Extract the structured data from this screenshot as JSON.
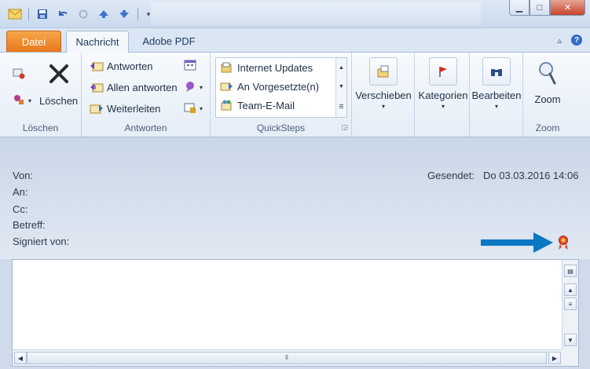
{
  "tabs": {
    "datei": "Datei",
    "nachricht": "Nachricht",
    "adobe_pdf": "Adobe PDF"
  },
  "ribbon": {
    "loeschen": {
      "delete_label": "Löschen",
      "group_label": "Löschen"
    },
    "antworten": {
      "reply": "Antworten",
      "reply_all": "Allen antworten",
      "forward": "Weiterleiten",
      "group_label": "Antworten"
    },
    "quicksteps": {
      "items": [
        "Internet Updates",
        "An Vorgesetzte(n)",
        "Team-E-Mail"
      ],
      "group_label": "QuickSteps"
    },
    "verschieben": "Verschieben",
    "kategorien": "Kategorien",
    "bearbeiten": "Bearbeiten",
    "zoom": {
      "label": "Zoom",
      "group_label": "Zoom"
    }
  },
  "header": {
    "from_label": "Von:",
    "to_label": "An:",
    "cc_label": "Cc:",
    "subject_label": "Betreff:",
    "signed_label": "Signiert von:",
    "sent_label": "Gesendet:",
    "sent_value": "Do 03.03.2016 14:06"
  },
  "colors": {
    "arrow": "#0a78c2",
    "datei_tab": "#e9761a",
    "close_button": "#c7432c"
  }
}
